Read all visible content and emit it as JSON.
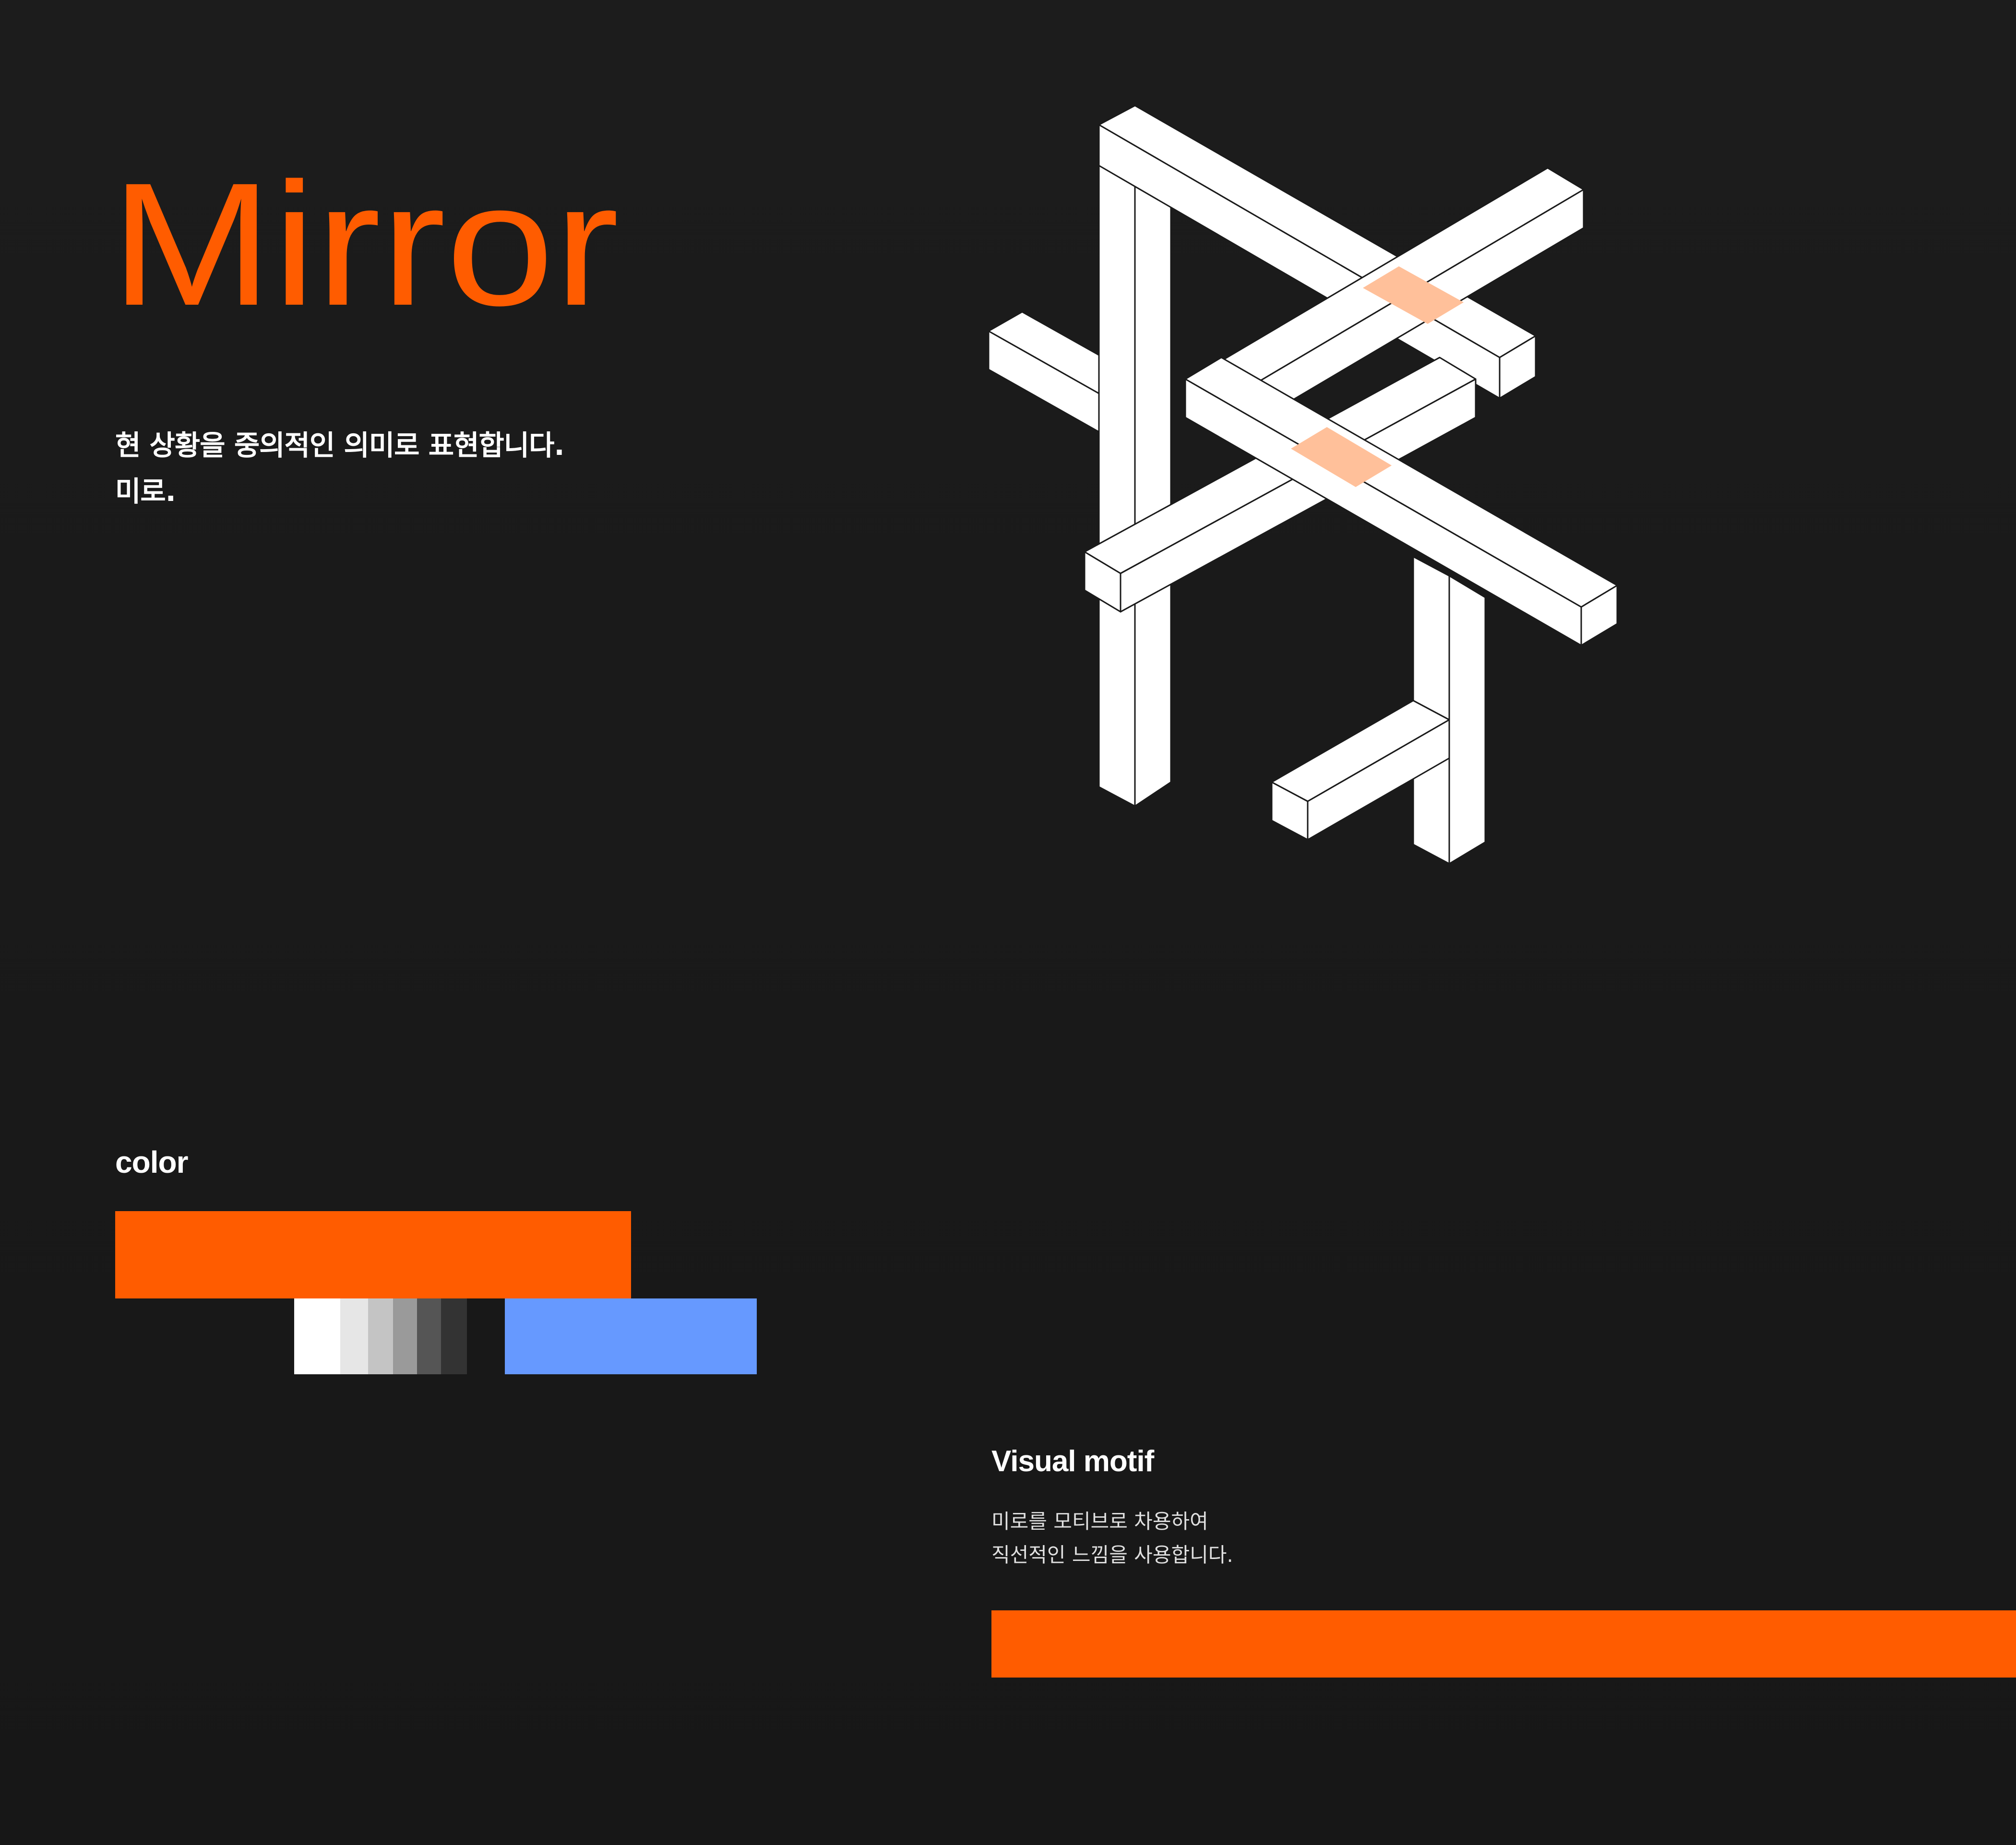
{
  "title": "Mirror",
  "intro": {
    "line1": "현 상황을 중의적인 의미로 표현합니다.",
    "line2": "미로."
  },
  "color_section": {
    "heading": "color",
    "primary": "#ff5c00",
    "secondary": "#6699ff",
    "grays": [
      "#ffffff",
      "#e6e6e6",
      "#c4c4c4",
      "#9a9a9a",
      "#555555",
      "#333333"
    ]
  },
  "motif_section": {
    "heading": "Visual motif",
    "desc_line1": "미로를 모티브로 차용하여",
    "desc_line2": "직선적인 느낌을 사용합니다.",
    "bar_color": "#ff5c00"
  },
  "illustration": {
    "fill": "#ffffff",
    "stroke": "#1a1a1a",
    "highlight": "#ffc09a"
  }
}
